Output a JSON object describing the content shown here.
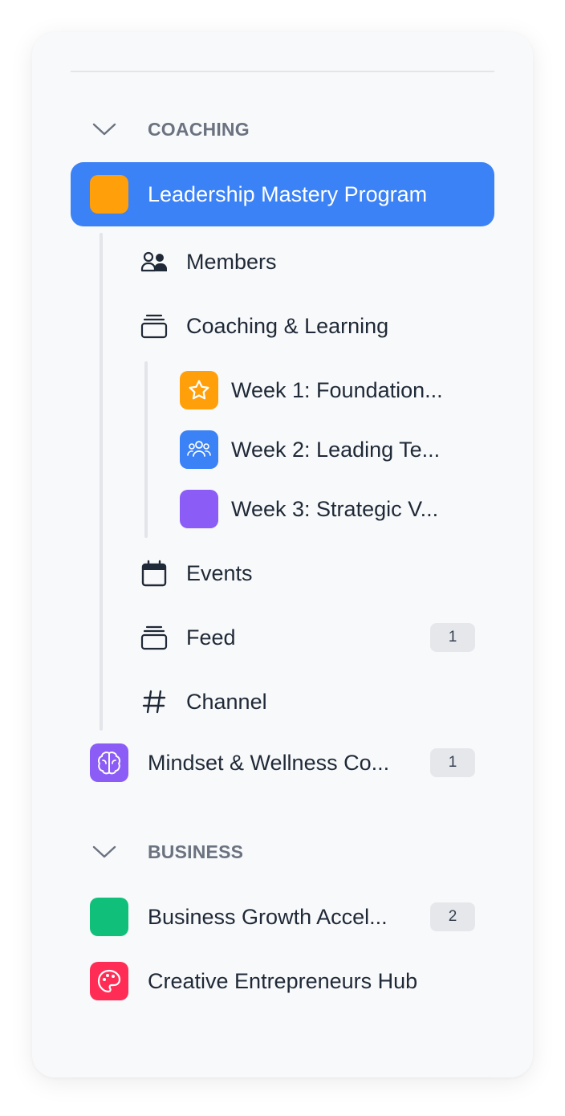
{
  "sections": [
    {
      "title": "COACHING"
    },
    {
      "title": "BUSINESS"
    }
  ],
  "active": {
    "label": "Leadership Mastery Program",
    "icon": "orange-square-icon",
    "color": "#ff9f0a"
  },
  "subitems": [
    {
      "label": "Members",
      "icon": "members-icon"
    },
    {
      "label": "Coaching & Learning",
      "icon": "stack-icon"
    },
    {
      "label": "Events",
      "icon": "calendar-icon"
    },
    {
      "label": "Feed",
      "icon": "stack-icon",
      "badge": "1"
    },
    {
      "label": "Channel",
      "icon": "hash-icon"
    }
  ],
  "weeks": [
    {
      "label": "Week 1: Foundation...",
      "icon": "star-icon",
      "color": "#ff9f0a"
    },
    {
      "label": "Week 2: Leading Te...",
      "icon": "team-icon",
      "color": "#3b82f6"
    },
    {
      "label": "Week 3: Strategic V...",
      "icon": "purple-square-icon",
      "color": "#8b5cf6"
    }
  ],
  "groups": [
    {
      "label": "Mindset & Wellness Co...",
      "icon": "brain-icon",
      "color": "#8b5cf6",
      "badge": "1"
    },
    {
      "label": "Business Growth Accel...",
      "icon": "green-square-icon",
      "color": "#10c07a",
      "badge": "2"
    },
    {
      "label": "Creative Entrepreneurs Hub",
      "icon": "palette-icon",
      "color": "#ff2d55"
    }
  ]
}
